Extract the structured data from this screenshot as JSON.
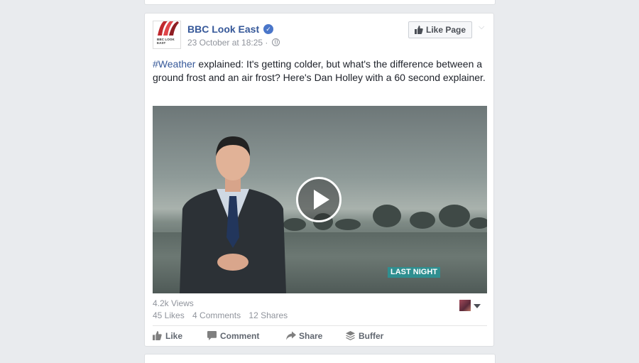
{
  "post": {
    "page_name": "BBC Look East",
    "verified_icon": "check-badge-icon",
    "timestamp": "23 October at 18:25 ·",
    "avatar_brand": "BBC LOOK EAST",
    "like_page_label": "Like Page",
    "text_hashtag": "#Weather",
    "text_body": " explained: It's getting colder, but what's the difference between a ground frost and an air frost? Here's Dan Holley with a 60 second explainer.",
    "video_caption": "LAST NIGHT",
    "views": "4.2k Views",
    "stats": {
      "likes": "45 Likes",
      "comments": "4 Comments",
      "shares": "12 Shares"
    },
    "actions": {
      "like": "Like",
      "comment": "Comment",
      "share": "Share",
      "buffer": "Buffer"
    }
  },
  "colors": {
    "link": "#365899",
    "background": "#e9ebee",
    "caption_bg": "#2f8f90",
    "muted": "#90949c"
  }
}
